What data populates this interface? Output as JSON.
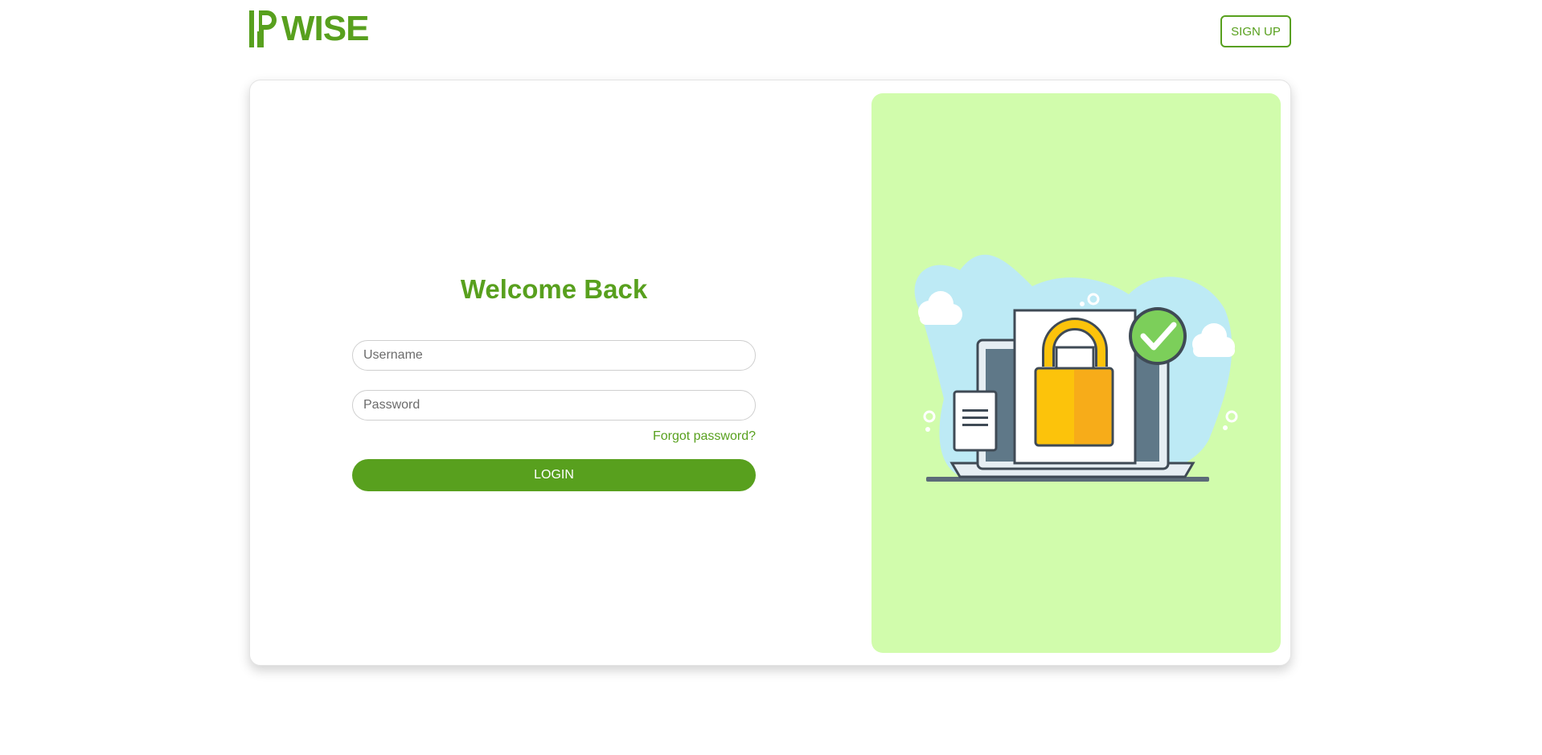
{
  "header": {
    "logo_text": "WISE",
    "signup_label": "SIGN UP"
  },
  "login_form": {
    "title": "Welcome Back",
    "username_placeholder": "Username",
    "password_placeholder": "Password",
    "forgot_label": "Forgot password?",
    "login_label": "LOGIN"
  },
  "colors": {
    "brand_green": "#58a01e",
    "panel_green": "#d1fcac",
    "lock_yellow": "#fcc30b",
    "check_green": "#7ccf5a"
  },
  "icons": {
    "logo": "bars-logo-icon",
    "illustration": "secure-laptop-lock-illustration"
  }
}
